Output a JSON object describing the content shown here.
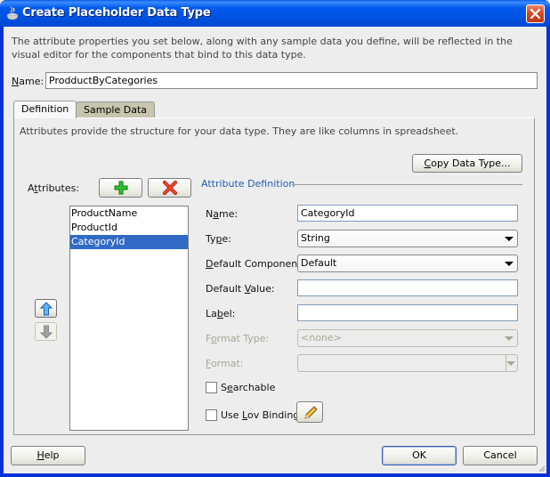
{
  "window": {
    "title": "Create Placeholder Data Type",
    "title_icon": "java-cup-icon",
    "close_icon": "close-icon"
  },
  "intro_text": "The attribute properties you set below, along with any sample data you define, will be reflected in the visual editor for the components that bind to this data type.",
  "name_field": {
    "label": "Name:",
    "value": "ProdductByCategories"
  },
  "tabs": [
    {
      "label": "Definition",
      "selected": true
    },
    {
      "label": "Sample Data",
      "selected": false
    }
  ],
  "definition": {
    "description": "Attributes provide the structure for your data type. They are like columns in spreadsheet.",
    "copy_button": "Copy Data Type...",
    "attributes_label": "Attributes:",
    "add_icon": "add-icon",
    "remove_icon": "remove-icon",
    "attributes": [
      {
        "name": "ProductName",
        "selected": false
      },
      {
        "name": "ProductId",
        "selected": false
      },
      {
        "name": "CategoryId",
        "selected": true
      }
    ],
    "move_up_icon": "arrow-up-icon",
    "move_down_icon": "arrow-down-icon",
    "attribute_definition": {
      "heading": "Attribute Definition",
      "name_label": "Name:",
      "name_value": "CategoryId",
      "type_label": "Type:",
      "type_value": "String",
      "default_component_label": "Default Component:",
      "default_component_value": "Default",
      "default_value_label": "Default Value:",
      "default_value_value": "",
      "label_label": "Label:",
      "label_value": "",
      "format_type_label": "Format Type:",
      "format_type_value": "<none>",
      "format_label": "Format:",
      "format_value": "",
      "searchable_label": "Searchable",
      "searchable_checked": false,
      "use_lov_label": "Use Lov Binding",
      "use_lov_checked": false,
      "edit_icon": "pencil-icon"
    }
  },
  "footer": {
    "help": "Help",
    "ok": "OK",
    "cancel": "Cancel"
  }
}
